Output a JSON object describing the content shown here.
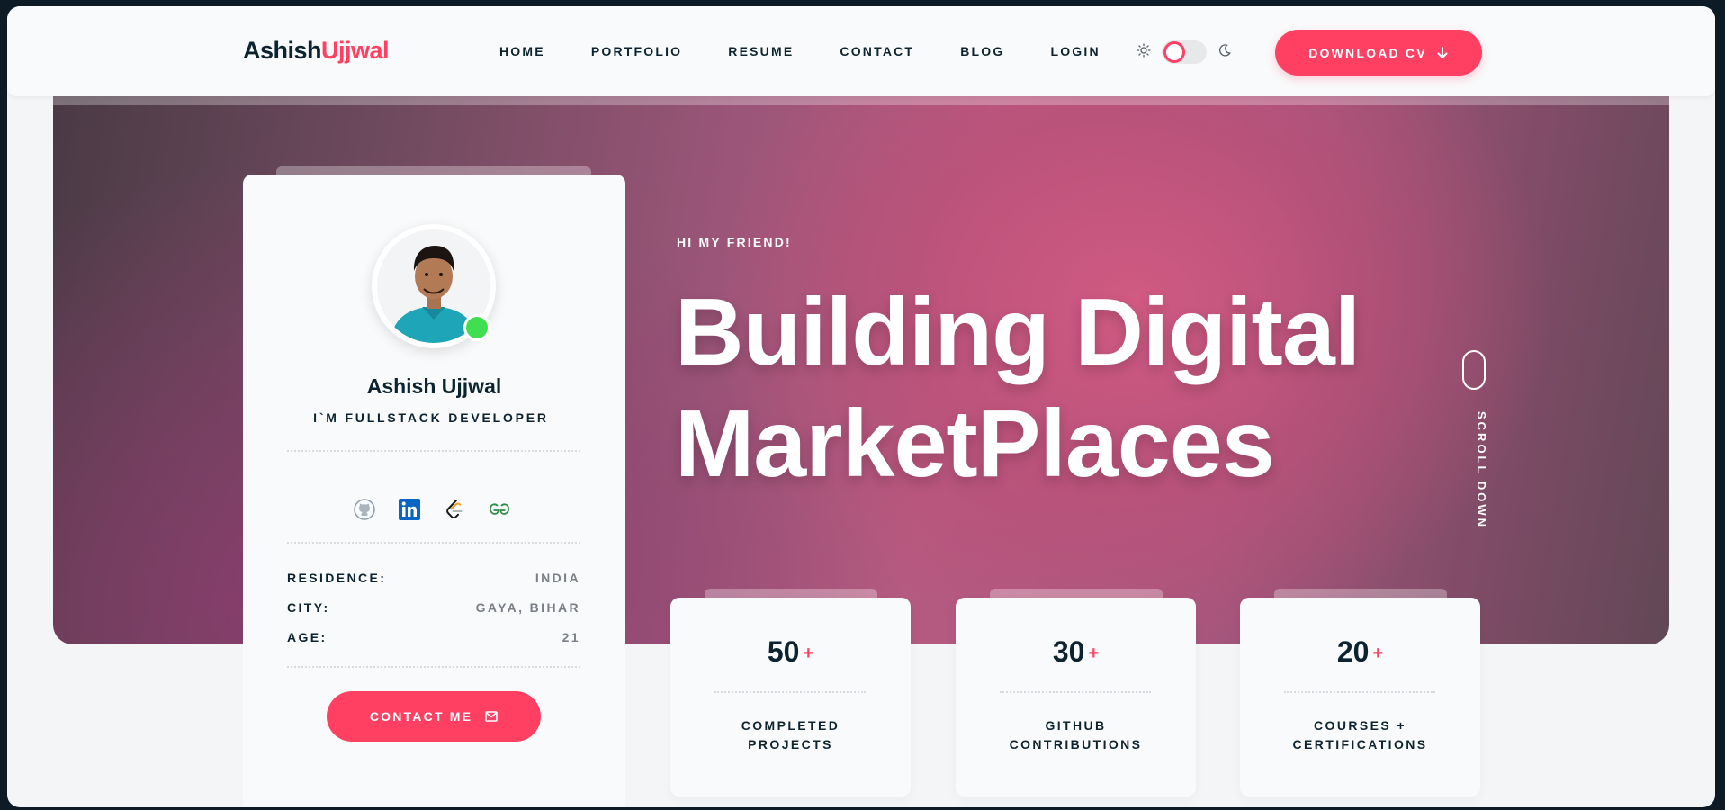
{
  "header": {
    "logo_first": "Ashish",
    "logo_second": "Ujjwal",
    "nav": [
      "HOME",
      "PORTFOLIO",
      "RESUME",
      "CONTACT",
      "BLOG",
      "LOGIN"
    ],
    "download_label": "DOWNLOAD CV"
  },
  "profile": {
    "name": "Ashish Ujjwal",
    "role": "I`M FULLSTACK DEVELOPER",
    "socials": [
      "github-icon",
      "linkedin-icon",
      "leetcode-icon",
      "geeksforgeeks-icon"
    ],
    "info": [
      {
        "key": "RESIDENCE:",
        "value": "INDIA"
      },
      {
        "key": "CITY:",
        "value": "GAYA, BIHAR"
      },
      {
        "key": "AGE:",
        "value": "21"
      }
    ],
    "contact_label": "CONTACT ME"
  },
  "hero": {
    "kicker": "HI MY FRIEND!",
    "headline_line1": "Building Digital",
    "headline_line2": "MarketPlaces",
    "scroll_label": "SCROLL DOWN"
  },
  "stats": [
    {
      "value": "50",
      "suffix": "+",
      "label_line1": "COMPLETED",
      "label_line2": "PROJECTS"
    },
    {
      "value": "30",
      "suffix": "+",
      "label_line1": "GITHUB",
      "label_line2": "CONTRIBUTIONS"
    },
    {
      "value": "20",
      "suffix": "+",
      "label_line1": "COURSES +",
      "label_line2": "CERTIFICATIONS"
    }
  ],
  "colors": {
    "accent": "#ff4062",
    "dark": "#0d2430",
    "online": "#40de50"
  }
}
